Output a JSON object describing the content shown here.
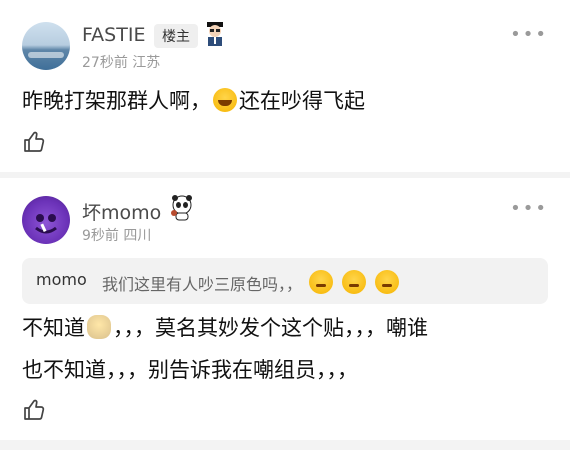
{
  "posts": [
    {
      "username": "FASTIE",
      "badge": "楼主",
      "meta": "27秒前 江苏",
      "text": "昨晚打架那群人啊，",
      "text_after_emoji": "还在吵得飞起",
      "emoji": "rolling-laughing-emoji"
    },
    {
      "username": "坏momo",
      "meta": "9秒前 四川",
      "quote": {
        "author": "momo",
        "text": "我们这里有人吵三原色吗，，",
        "emoji": "thinking-face-emoji"
      },
      "text_line1_a": "不知道",
      "text_line1_b": "，，，莫名其妙发个这个贴，，，嘲谁",
      "text_line2": "也不知道，，，别告诉我在嘲组员，，，",
      "emoji": "shrug-emoji"
    }
  ],
  "icons": {
    "more": "more-dots-icon",
    "like": "thumbs-up-icon"
  },
  "colors": {
    "text": "#111111",
    "muted": "#9a9a9a",
    "quote_bg": "#f2f2f2",
    "separator": "#f3f3f3"
  }
}
